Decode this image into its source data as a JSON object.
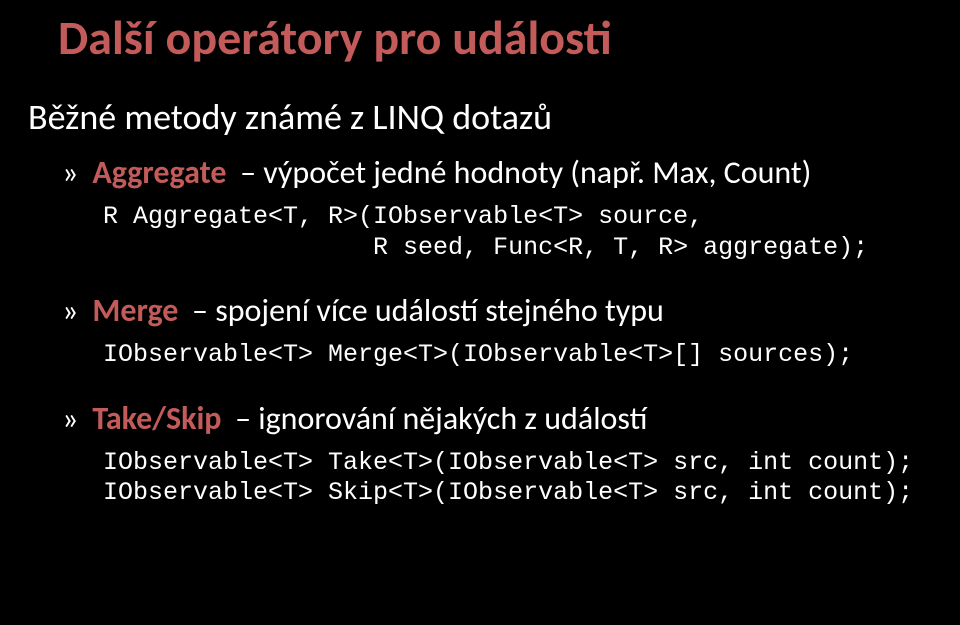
{
  "title": "Další operátory pro události",
  "subtitle": "Běžné metody známé z LINQ dotazů",
  "items": [
    {
      "marker": "»",
      "keyword": "Aggregate",
      "desc": "– výpočet jedné hodnoty (např. Max, Count)",
      "code": "R Aggregate<T, R>(IObservable<T> source,\n                  R seed, Func<R, T, R> aggregate);"
    },
    {
      "marker": "»",
      "keyword": "Merge",
      "desc": "– spojení více událostí stejného typu",
      "code": "IObservable<T> Merge<T>(IObservable<T>[] sources);"
    },
    {
      "marker": "»",
      "keyword": "Take/Skip",
      "desc": "– ignorování nějakých z událostí",
      "code": "IObservable<T> Take<T>(IObservable<T> src, int count);\nIObservable<T> Skip<T>(IObservable<T> src, int count);"
    }
  ]
}
